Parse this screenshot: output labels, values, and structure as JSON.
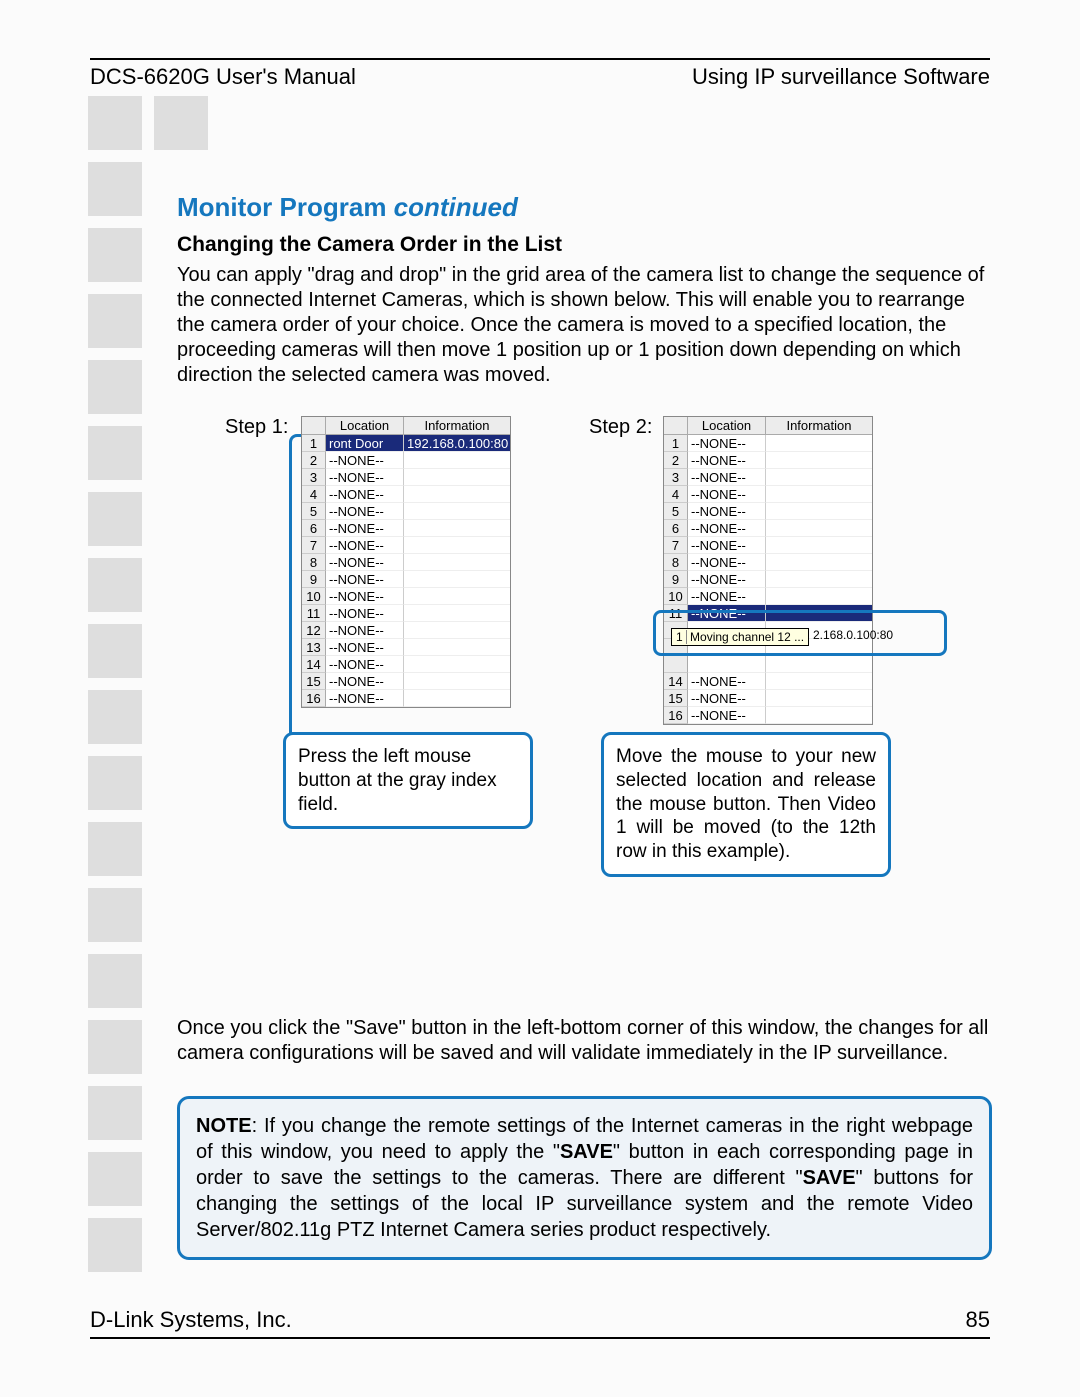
{
  "header": {
    "left": "DCS-6620G User's Manual",
    "right": "Using IP surveillance Software"
  },
  "title": {
    "main": "Monitor Program ",
    "cont": "continued"
  },
  "subtitle": "Changing the Camera Order in the List",
  "paragraph1": "You can apply \"drag and drop\" in the grid area of the camera list to change the sequence of the connected Internet Cameras, which is shown below. This will enable you to rearrange the camera order of your choice. Once the camera is moved to a specified location, the proceeding cameras will then move 1 position up or 1 position down depending on which direction the selected camera was moved.",
  "step1_label": "Step 1:",
  "step2_label": "Step 2:",
  "table_headers": {
    "loc": "Location",
    "info": "Information"
  },
  "step1_rows": [
    {
      "n": "1",
      "loc": "ront Door",
      "info": "192.168.0.100:80",
      "sel": true
    },
    {
      "n": "2",
      "loc": "--NONE--",
      "info": ""
    },
    {
      "n": "3",
      "loc": "--NONE--",
      "info": ""
    },
    {
      "n": "4",
      "loc": "--NONE--",
      "info": ""
    },
    {
      "n": "5",
      "loc": "--NONE--",
      "info": ""
    },
    {
      "n": "6",
      "loc": "--NONE--",
      "info": ""
    },
    {
      "n": "7",
      "loc": "--NONE--",
      "info": ""
    },
    {
      "n": "8",
      "loc": "--NONE--",
      "info": ""
    },
    {
      "n": "9",
      "loc": "--NONE--",
      "info": ""
    },
    {
      "n": "10",
      "loc": "--NONE--",
      "info": ""
    },
    {
      "n": "11",
      "loc": "--NONE--",
      "info": ""
    },
    {
      "n": "12",
      "loc": "--NONE--",
      "info": ""
    },
    {
      "n": "13",
      "loc": "--NONE--",
      "info": ""
    },
    {
      "n": "14",
      "loc": "--NONE--",
      "info": ""
    },
    {
      "n": "15",
      "loc": "--NONE--",
      "info": ""
    },
    {
      "n": "16",
      "loc": "--NONE--",
      "info": ""
    }
  ],
  "step2_rows": [
    {
      "n": "1",
      "loc": "--NONE--",
      "info": ""
    },
    {
      "n": "2",
      "loc": "--NONE--",
      "info": ""
    },
    {
      "n": "3",
      "loc": "--NONE--",
      "info": ""
    },
    {
      "n": "4",
      "loc": "--NONE--",
      "info": ""
    },
    {
      "n": "5",
      "loc": "--NONE--",
      "info": ""
    },
    {
      "n": "6",
      "loc": "--NONE--",
      "info": ""
    },
    {
      "n": "7",
      "loc": "--NONE--",
      "info": ""
    },
    {
      "n": "8",
      "loc": "--NONE--",
      "info": ""
    },
    {
      "n": "9",
      "loc": "--NONE--",
      "info": ""
    },
    {
      "n": "10",
      "loc": "--NONE--",
      "info": ""
    },
    {
      "n": "11",
      "loc": "--NONE--",
      "info": "",
      "sel": true
    },
    {
      "n": "14",
      "loc": "--NONE--",
      "info": ""
    },
    {
      "n": "15",
      "loc": "--NONE--",
      "info": ""
    },
    {
      "n": "16",
      "loc": "--NONE--",
      "info": ""
    }
  ],
  "drag_tooltip_num": "1",
  "drag_tooltip": "Moving channel 12 ...",
  "drag_ip": "2.168.0.100:80",
  "callout1": "Press the left mouse button at the gray index field.",
  "callout2": "Move the mouse to your new selected location and release the mouse button. Then Video 1 will be moved (to the 12th row in this example).",
  "paragraph2": "Once you click the \"Save\" button in the left-bottom corner of this window, the changes for all camera configurations will be saved and will validate immediately in the IP surveillance.",
  "note": {
    "label": "NOTE",
    "part1": ": If you change the remote settings of the Internet cameras in the right webpage of this window, you need to apply the \"",
    "save1": "SAVE",
    "part2": "\" button in each corresponding page in order to save the settings to the cameras. There are different \"",
    "save2": "SAVE",
    "part3": "\" buttons for changing the settings of the local IP surveillance system and the remote Video Server/802.11g PTZ Internet Camera series product respectively."
  },
  "footer": {
    "left": "D-Link Systems, Inc.",
    "right": "85"
  }
}
